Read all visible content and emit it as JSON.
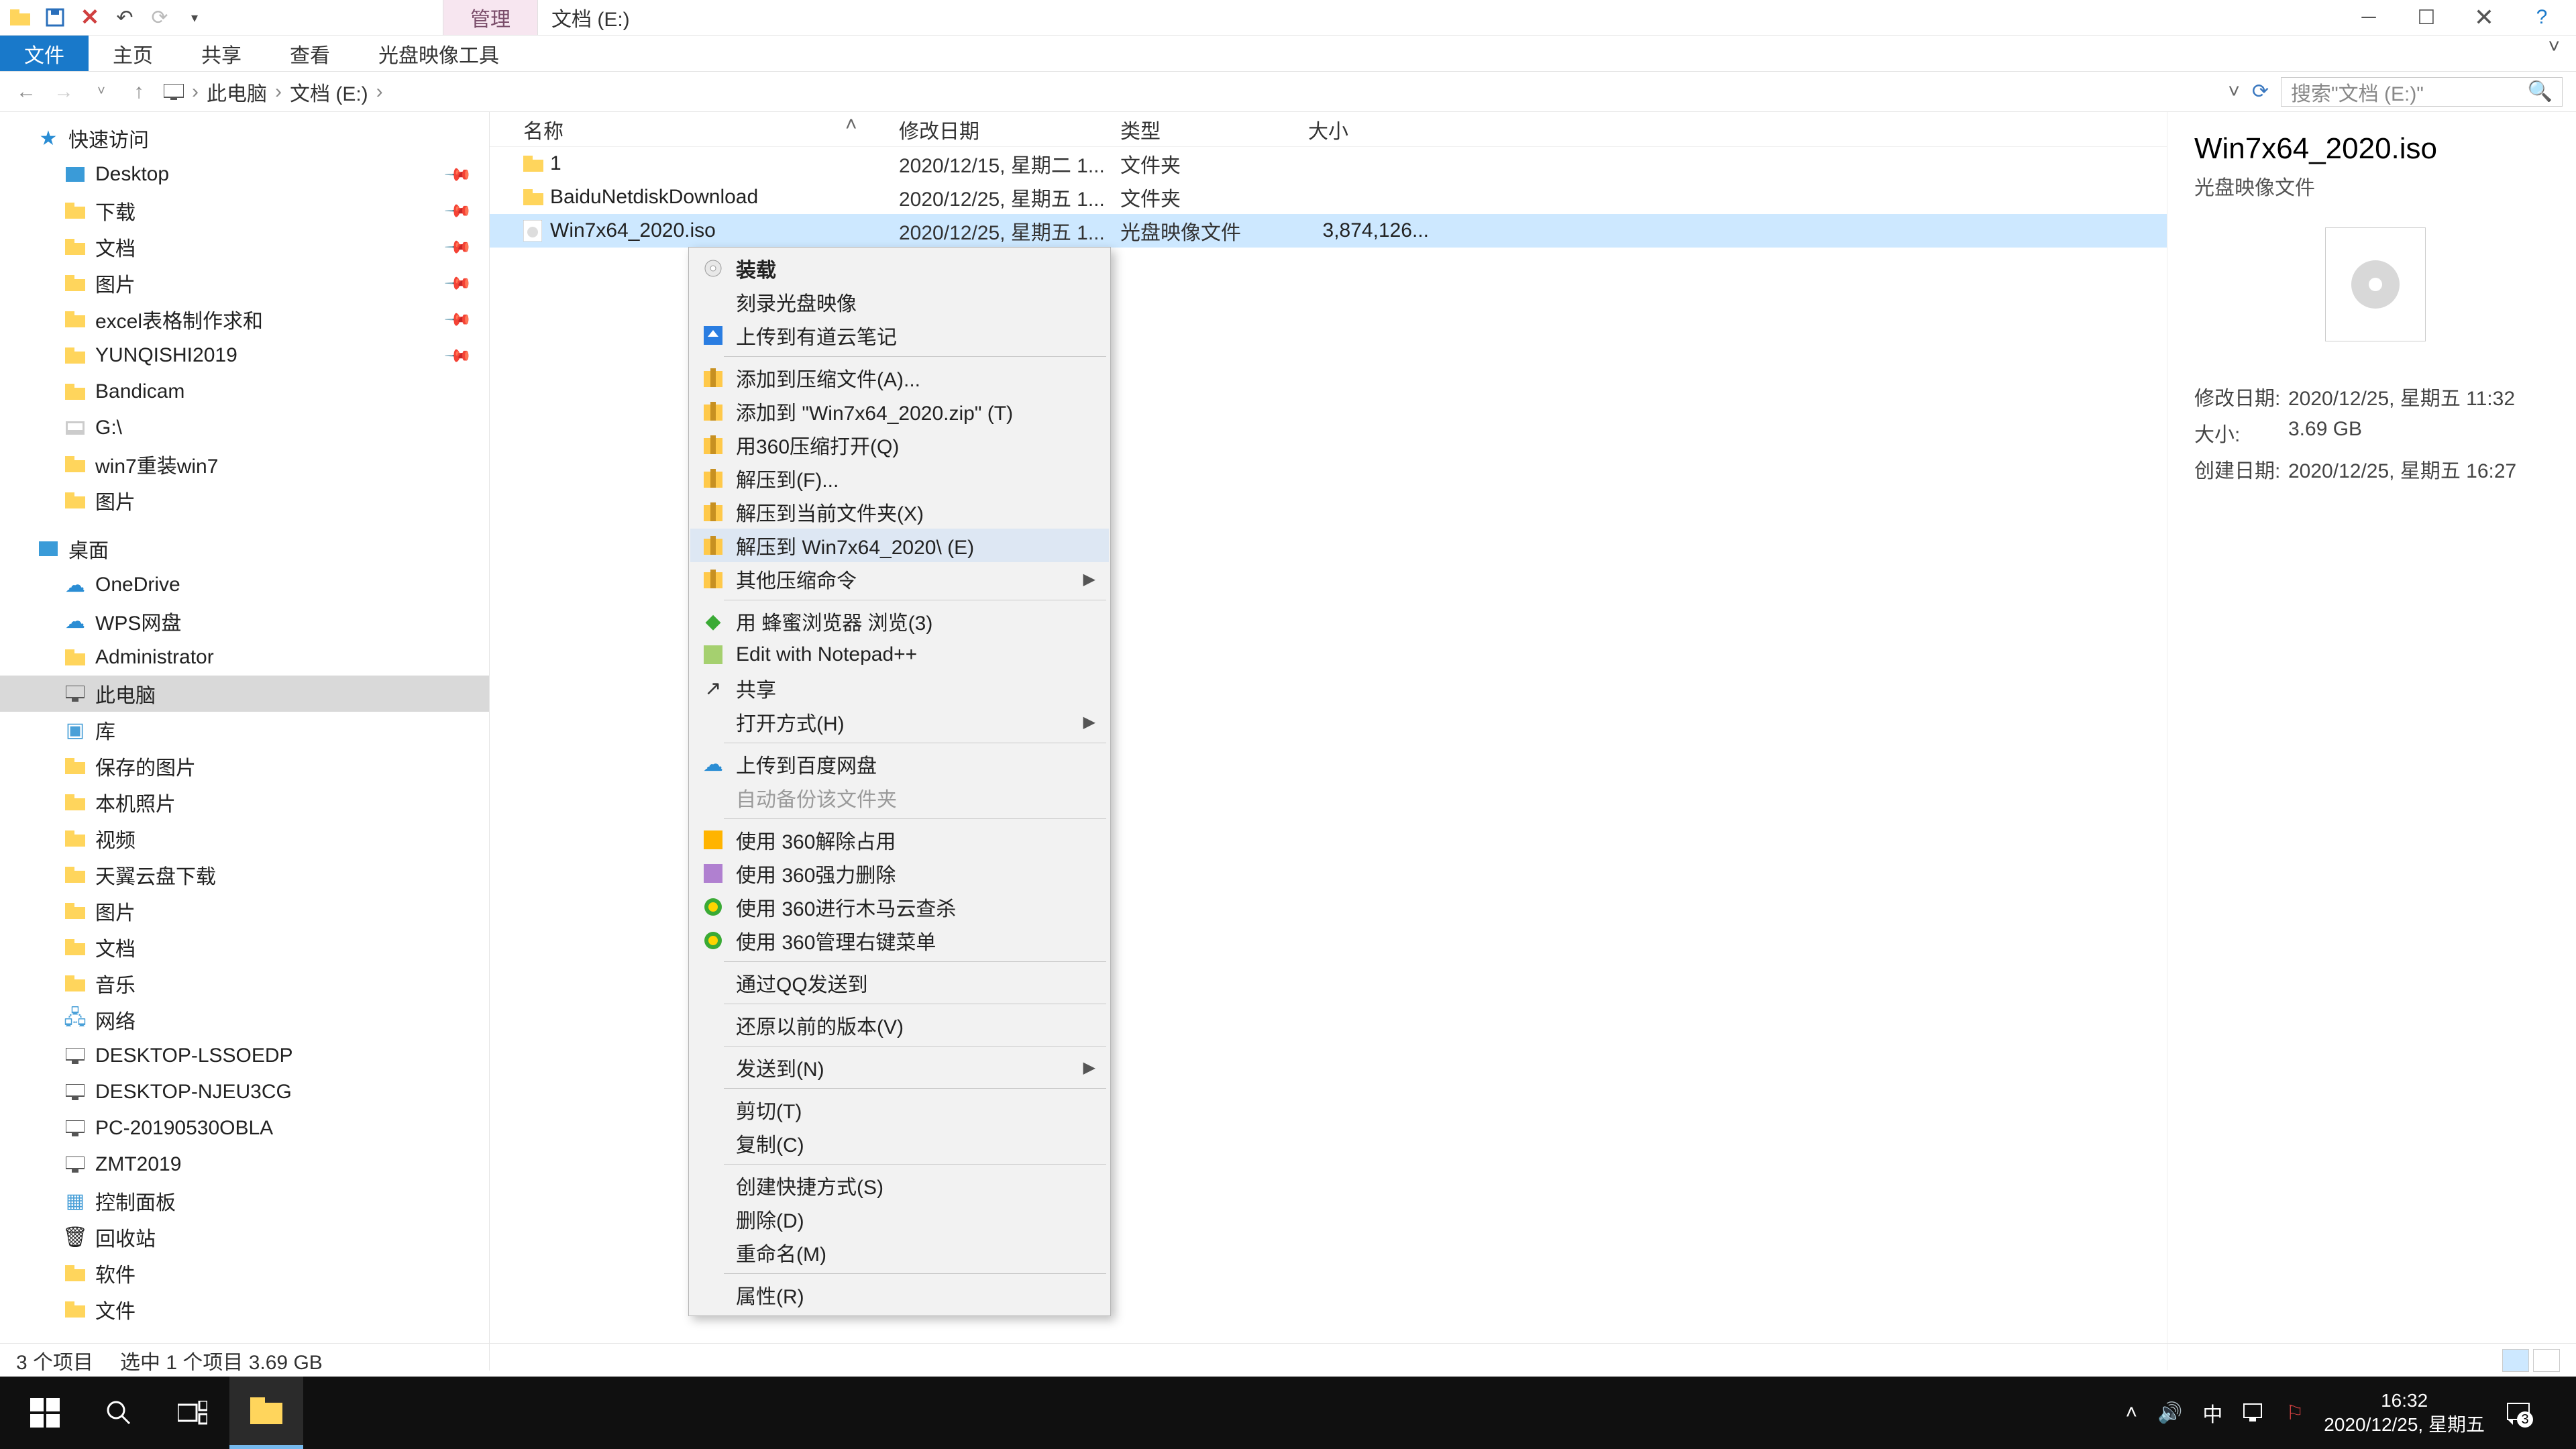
{
  "title_tabs": {
    "manage": "管理",
    "drive": "文档 (E:)"
  },
  "ribbon": {
    "file": "文件",
    "home": "主页",
    "share": "共享",
    "view": "查看",
    "disc": "光盘映像工具"
  },
  "breadcrumb": {
    "pc": "此电脑",
    "drive": "文档 (E:)"
  },
  "search": {
    "placeholder": "搜索\"文档 (E:)\""
  },
  "columns": {
    "name": "名称",
    "modified": "修改日期",
    "type": "类型",
    "size": "大小"
  },
  "rows": [
    {
      "name": "1",
      "modified": "2020/12/15, 星期二 1...",
      "type": "文件夹",
      "size": ""
    },
    {
      "name": "BaiduNetdiskDownload",
      "modified": "2020/12/25, 星期五 1...",
      "type": "文件夹",
      "size": ""
    },
    {
      "name": "Win7x64_2020.iso",
      "modified": "2020/12/25, 星期五 1...",
      "type": "光盘映像文件",
      "size": "3,874,126..."
    }
  ],
  "sidebar": {
    "quick": "快速访问",
    "quick_items": [
      "Desktop",
      "下载",
      "文档",
      "图片",
      "excel表格制作求和",
      "YUNQISHI2019",
      "Bandicam",
      "G:\\",
      "win7重装win7",
      "图片"
    ],
    "pins": [
      true,
      true,
      true,
      true,
      true,
      true,
      false,
      false,
      false,
      false
    ],
    "desktop": "桌面",
    "desktop_items": [
      "OneDrive",
      "WPS网盘",
      "Administrator",
      "此电脑",
      "库",
      "保存的图片",
      "本机照片",
      "视频",
      "天翼云盘下载",
      "图片",
      "文档",
      "音乐",
      "网络",
      "DESKTOP-LSSOEDP",
      "DESKTOP-NJEU3CG",
      "PC-20190530OBLA",
      "ZMT2019",
      "控制面板",
      "回收站",
      "软件",
      "文件"
    ]
  },
  "context_menu": [
    {
      "label": "装载",
      "bold": true,
      "icon": "disc"
    },
    {
      "label": "刻录光盘映像"
    },
    {
      "label": "上传到有道云笔记",
      "icon": "blue-up"
    },
    {
      "sep": true
    },
    {
      "label": "添加到压缩文件(A)...",
      "icon": "archive"
    },
    {
      "label": "添加到 \"Win7x64_2020.zip\" (T)",
      "icon": "archive"
    },
    {
      "label": "用360压缩打开(Q)",
      "icon": "archive"
    },
    {
      "label": "解压到(F)...",
      "icon": "archive"
    },
    {
      "label": "解压到当前文件夹(X)",
      "icon": "archive"
    },
    {
      "label": "解压到 Win7x64_2020\\ (E)",
      "icon": "archive",
      "hover": true
    },
    {
      "label": "其他压缩命令",
      "icon": "archive",
      "sub": true
    },
    {
      "sep": true
    },
    {
      "label": "用 蜂蜜浏览器 浏览(3)",
      "icon": "green"
    },
    {
      "label": "Edit with Notepad++",
      "icon": "npp"
    },
    {
      "label": "共享",
      "icon": "share"
    },
    {
      "label": "打开方式(H)",
      "sub": true
    },
    {
      "sep": true
    },
    {
      "label": "上传到百度网盘",
      "icon": "cloud"
    },
    {
      "label": "自动备份该文件夹",
      "disabled": true
    },
    {
      "sep": true
    },
    {
      "label": "使用 360解除占用",
      "icon": "360y"
    },
    {
      "label": "使用 360强力删除",
      "icon": "360p"
    },
    {
      "label": "使用 360进行木马云查杀",
      "icon": "360g"
    },
    {
      "label": "使用 360管理右键菜单",
      "icon": "360g"
    },
    {
      "sep": true
    },
    {
      "label": "通过QQ发送到"
    },
    {
      "sep": true
    },
    {
      "label": "还原以前的版本(V)"
    },
    {
      "sep": true
    },
    {
      "label": "发送到(N)",
      "sub": true
    },
    {
      "sep": true
    },
    {
      "label": "剪切(T)"
    },
    {
      "label": "复制(C)"
    },
    {
      "sep": true
    },
    {
      "label": "创建快捷方式(S)"
    },
    {
      "label": "删除(D)"
    },
    {
      "label": "重命名(M)"
    },
    {
      "sep": true
    },
    {
      "label": "属性(R)"
    }
  ],
  "preview": {
    "title": "Win7x64_2020.iso",
    "subtitle": "光盘映像文件",
    "meta": {
      "mod_label": "修改日期:",
      "mod_val": "2020/12/25, 星期五 11:32",
      "size_label": "大小:",
      "size_val": "3.69 GB",
      "created_label": "创建日期:",
      "created_val": "2020/12/25, 星期五 16:27"
    }
  },
  "status": {
    "count": "3 个项目",
    "selected": "选中 1 个项目  3.69 GB"
  },
  "taskbar": {
    "ime": "中",
    "time": "16:32",
    "date": "2020/12/25, 星期五",
    "badge": "3"
  }
}
